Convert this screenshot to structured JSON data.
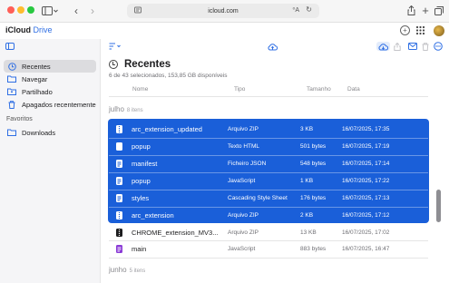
{
  "browser": {
    "address": "icloud.com",
    "translate_glyph": "⁰A",
    "reload_glyph": "↻"
  },
  "header": {
    "brand_apple": "",
    "brand_icloud": "iCloud",
    "brand_drive": "Drive"
  },
  "sidebar": {
    "items": [
      {
        "label": "Recentes",
        "icon": "clock-icon",
        "selected": true
      },
      {
        "label": "Navegar",
        "icon": "folder-icon",
        "selected": false
      },
      {
        "label": "Partilhado",
        "icon": "shared-folder-icon",
        "selected": false
      },
      {
        "label": "Apagados recentemente",
        "icon": "trash-icon",
        "selected": false
      }
    ],
    "favorites_title": "Favoritos",
    "favorites": [
      {
        "label": "Downloads",
        "icon": "folder-icon"
      }
    ]
  },
  "main": {
    "title": "Recentes",
    "subtitle": "6 de 43 selecionados, 153,85 GB disponíveis",
    "columns": {
      "name": "Nome",
      "type": "Tipo",
      "size": "Tamanho",
      "date": "Data"
    },
    "groups": [
      {
        "label": "julho",
        "count": "8 itens"
      },
      {
        "label": "junho",
        "count": "5 itens"
      }
    ],
    "rows": [
      {
        "name": "arc_extension_updated",
        "type": "Arquivo ZIP",
        "size": "3 KB",
        "date": "16/07/2025, 17:35",
        "selected": true,
        "icon": "zip-icon"
      },
      {
        "name": "popup",
        "type": "Texto HTML",
        "size": "501 bytes",
        "date": "16/07/2025, 17:19",
        "selected": true,
        "icon": "html-file-icon"
      },
      {
        "name": "manifest",
        "type": "Ficheiro JSON",
        "size": "548 bytes",
        "date": "16/07/2025, 17:14",
        "selected": true,
        "icon": "json-file-icon"
      },
      {
        "name": "popup",
        "type": "JavaScript",
        "size": "1 KB",
        "date": "16/07/2025, 17:22",
        "selected": true,
        "icon": "js-file-icon"
      },
      {
        "name": "styles",
        "type": "Cascading Style Sheet",
        "size": "176 bytes",
        "date": "16/07/2025, 17:13",
        "selected": true,
        "icon": "css-file-icon"
      },
      {
        "name": "arc_extension",
        "type": "Arquivo ZIP",
        "size": "2 KB",
        "date": "16/07/2025, 17:12",
        "selected": true,
        "icon": "zip-icon"
      },
      {
        "name": "CHROME_extension_MV3...",
        "type": "Arquivo ZIP",
        "size": "13 KB",
        "date": "16/07/2025, 17:02",
        "selected": false,
        "icon": "zip-icon"
      },
      {
        "name": "main",
        "type": "JavaScript",
        "size": "883 bytes",
        "date": "16/07/2025, 16:47",
        "selected": false,
        "icon": "js-file-icon"
      }
    ]
  }
}
